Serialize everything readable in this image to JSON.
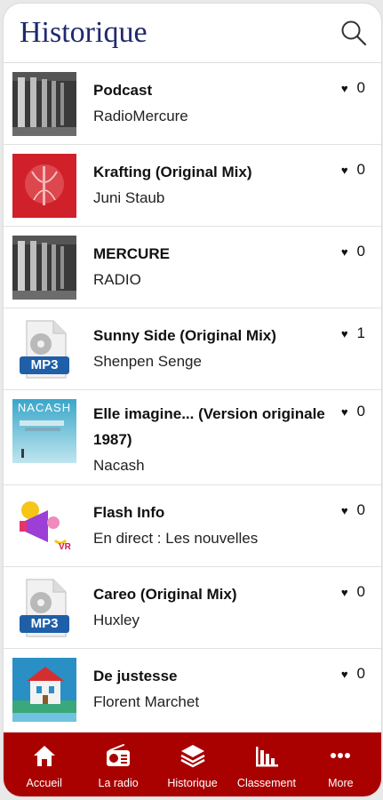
{
  "header": {
    "title": "Historique",
    "search_icon": "search-icon"
  },
  "history": [
    {
      "title": "Podcast",
      "artist": "RadioMercure",
      "likes": "0",
      "thumb": "radio-hall-photo"
    },
    {
      "title": "Krafting (Original Mix)",
      "artist": "Juni Staub",
      "likes": "0",
      "thumb": "red-cover-art"
    },
    {
      "title": "MERCURE",
      "artist": "RADIO",
      "likes": "0",
      "thumb": "radio-hall-photo"
    },
    {
      "title": "Sunny Side (Original Mix)",
      "artist": "Shenpen Senge",
      "likes": "1",
      "thumb": "mp3-file-icon"
    },
    {
      "title": "Elle imagine... (Version originale 1987)",
      "artist": "Nacash",
      "likes": "0",
      "thumb": "nacash-cover"
    },
    {
      "title": "Flash Info",
      "artist": "En direct : Les nouvelles",
      "likes": "0",
      "thumb": "megaphone-logo"
    },
    {
      "title": "Careo (Original Mix)",
      "artist": "Huxley",
      "likes": "0",
      "thumb": "mp3-file-icon"
    },
    {
      "title": "De justesse",
      "artist": "Florent Marchet",
      "likes": "0",
      "thumb": "house-cover-art"
    }
  ],
  "thumb_labels": {
    "mp3": "MP3",
    "nacash": "NACASH",
    "vr": "VR"
  },
  "tabs": [
    {
      "label": "Accueil",
      "icon": "home-icon"
    },
    {
      "label": "La radio",
      "icon": "radio-icon"
    },
    {
      "label": "Historique",
      "icon": "layers-icon"
    },
    {
      "label": "Classement",
      "icon": "bar-chart-icon"
    },
    {
      "label": "More",
      "icon": "more-icon"
    }
  ],
  "colors": {
    "title": "#1f2a6e",
    "tabbar": "#a90000"
  }
}
